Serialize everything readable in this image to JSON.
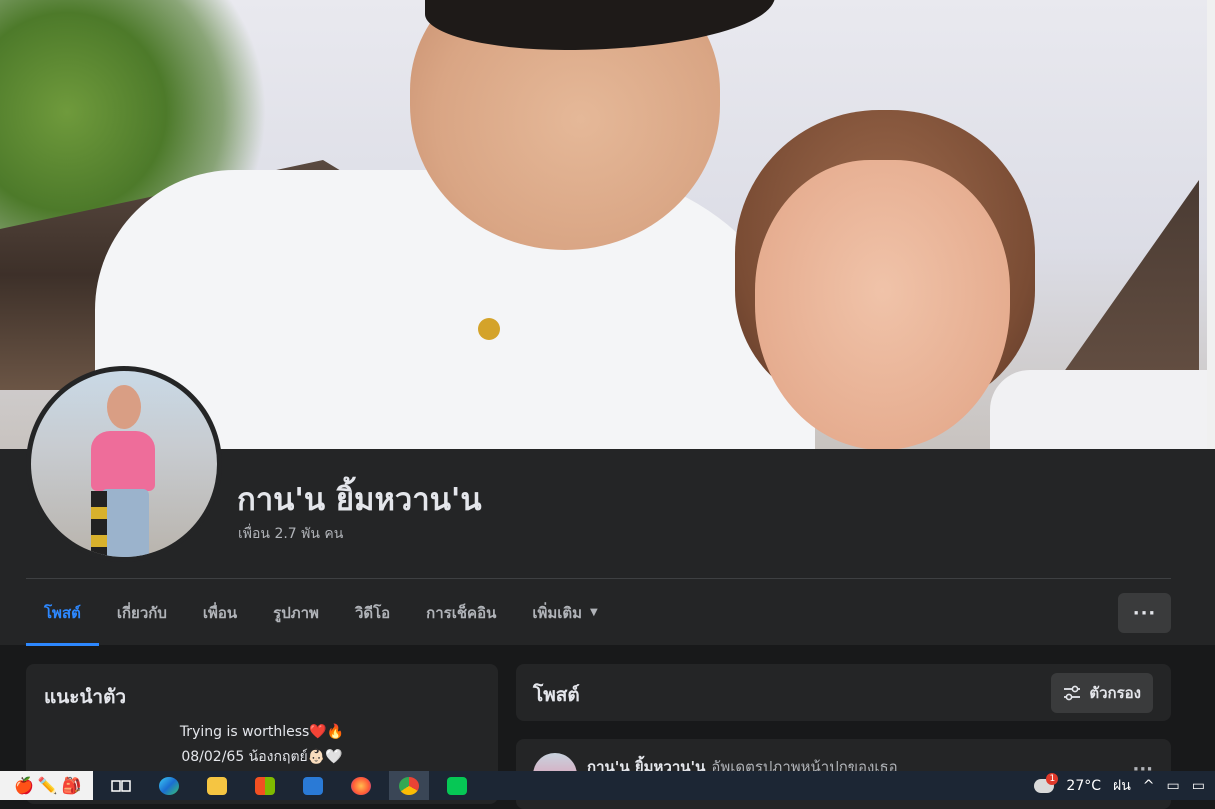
{
  "profile": {
    "name": "กาน'น ยิ้มหวาน'น",
    "friends": "เพื่อน 2.7 พัน คน"
  },
  "tabs": [
    {
      "label": "โพสต์",
      "active": true
    },
    {
      "label": "เกี่ยวกับ"
    },
    {
      "label": "เพื่อน"
    },
    {
      "label": "รูปภาพ"
    },
    {
      "label": "วิดีโอ"
    },
    {
      "label": "การเช็คอิน"
    },
    {
      "label": "เพิ่มเติม",
      "has_dropdown": true
    }
  ],
  "more_button": "···",
  "intro": {
    "title": "แนะนำตัว",
    "bio": [
      "Trying is worthless❤️🔥",
      "08/02/65 น้องกฤตย์👶🏻🤍",
      "..."
    ]
  },
  "posts_header": {
    "title": "โพสต์",
    "filter_label": "ตัวกรอง"
  },
  "post": {
    "author": "กาน'น ยิ้มหวาน'น",
    "action": "อัพเดตรูปภาพหน้าปกของเธอ"
  },
  "taskbar": {
    "temperature": "27°C",
    "weather": "ฝน",
    "notification_count": "1"
  },
  "colors": {
    "accent": "#2d88ff",
    "surface": "#242526",
    "background": "#18191a"
  }
}
